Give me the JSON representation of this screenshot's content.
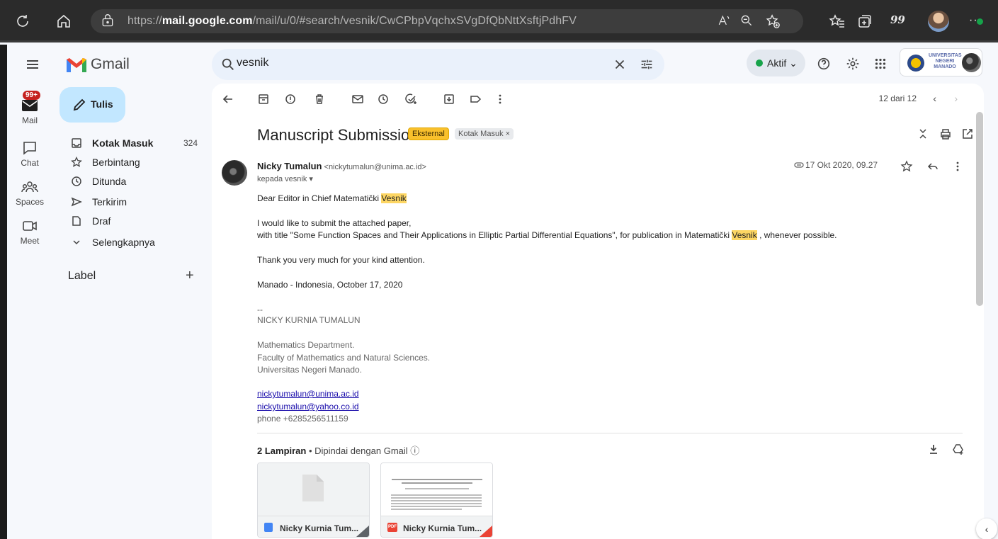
{
  "browser": {
    "url_prefix": "https://",
    "url_host": "mail.google.com",
    "url_path": "/mail/u/0/#search/vesnik/CwCPbpVqchxSVgDfQbNttXsftjPdhFV",
    "ext_badge": "99"
  },
  "app": {
    "name": "Gmail"
  },
  "search": {
    "query": "vesnik"
  },
  "status": {
    "label": "Aktif"
  },
  "org": {
    "name": "UNIVERSITAS NEGERI MANADO"
  },
  "rail": {
    "badge": "99+",
    "items": [
      {
        "label": "Mail"
      },
      {
        "label": "Chat"
      },
      {
        "label": "Spaces"
      },
      {
        "label": "Meet"
      }
    ]
  },
  "nav": {
    "compose": "Tulis",
    "items": [
      {
        "label": "Kotak Masuk",
        "count": "324"
      },
      {
        "label": "Berbintang"
      },
      {
        "label": "Ditunda"
      },
      {
        "label": "Terkirim"
      },
      {
        "label": "Draf"
      },
      {
        "label": "Selengkapnya"
      }
    ],
    "labels_header": "Label"
  },
  "toolbar": {
    "pager": "12 dari 12"
  },
  "message": {
    "subject": "Manuscript Submission",
    "chip_external": "Eksternal",
    "chip_inbox": "Kotak Masuk ×",
    "sender_name": "Nicky Tumalun",
    "sender_email": "<nickytumalun@unima.ac.id>",
    "recipient": "kepada vesnik ▾",
    "time": "17 Okt 2020, 09.27",
    "greeting_pre": "Dear Editor in Chief Matematički ",
    "keyword": "Vesnik",
    "para1_line1": "I would like to submit the attached paper,",
    "para1_line2_pre": "with title \"Some Function Spaces and Their Applications in Elliptic Partial Differential Equations\", for publication in Matematički ",
    "para1_line2_post": " , whenever possible.",
    "thanks": "Thank you very much for your kind attention.",
    "place_date": "Manado - Indonesia, October 17, 2020",
    "sig_dash": "--",
    "sig_name": "NICKY KURNIA TUMALUN",
    "sig_dept": "Mathematics Department.",
    "sig_faculty": "Faculty of Mathematics and Natural Sciences.",
    "sig_univ": "Universitas Negeri Manado.",
    "sig_email1": "nickytumalun@unima.ac.id",
    "sig_email2": "nickytumalun@yahoo.co.id",
    "sig_phone": "phone +6285256511159"
  },
  "attachments": {
    "count_label": "2 Lampiran",
    "scan_label": " •  Dipindai dengan Gmail ⓘ",
    "items": [
      {
        "name": "Nicky Kurnia Tum...",
        "type": "doc",
        "icon_color": "#4285f4"
      },
      {
        "name": "Nicky Kurnia Tum...",
        "type": "pdf",
        "icon_color": "#ea4335",
        "icon_text": "PDF"
      }
    ]
  },
  "colors": {
    "accent": "#c2e7ff",
    "highlight": "#fdd663",
    "external": "#f9c02c",
    "badge": "#c5221f"
  }
}
